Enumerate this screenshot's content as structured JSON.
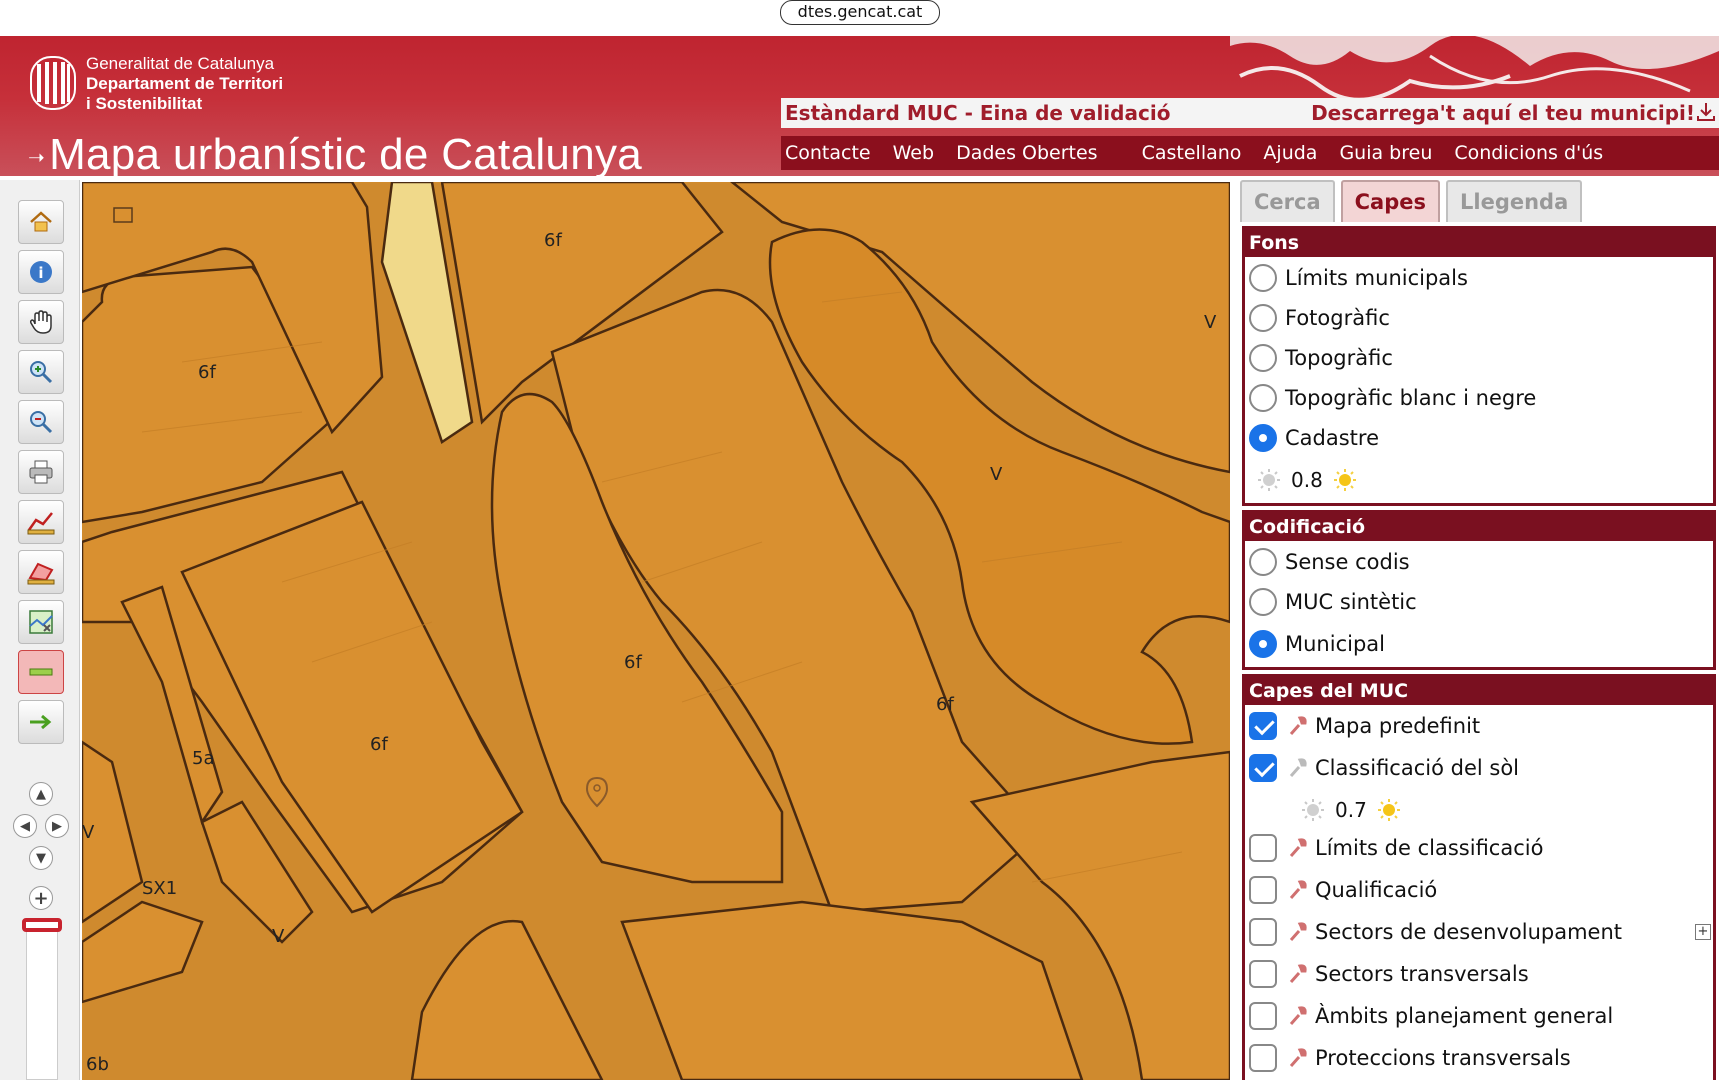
{
  "browser": {
    "url": "dtes.gencat.cat"
  },
  "header": {
    "org_line1": "Generalitat de Catalunya",
    "org_line2": "Departament de Territori",
    "org_line3": "i Sostenibilitat",
    "site_title": "Mapa urbanístic de Catalunya",
    "muc_standard": "Estàndard MUC - Eina de validació",
    "muc_download": "Descarrega't aquí el teu municipi!",
    "nav": [
      {
        "label": "Contacte"
      },
      {
        "label": "Web"
      },
      {
        "label": "Dades Obertes"
      },
      {
        "label": "Castellano"
      },
      {
        "label": "Ajuda"
      },
      {
        "label": "Guia breu"
      },
      {
        "label": "Condicions d'ús"
      }
    ]
  },
  "toolbar": {
    "tools": [
      "home-icon",
      "info-icon",
      "pan-hand-icon",
      "zoom-in-icon",
      "zoom-out-icon",
      "print-icon",
      "measure-distance-icon",
      "measure-area-icon",
      "map-select-icon",
      "layer-bar-icon",
      "next-arrow-icon"
    ]
  },
  "map": {
    "labels": [
      {
        "text": "6f"
      },
      {
        "text": "6f"
      },
      {
        "text": "V"
      },
      {
        "text": "V"
      },
      {
        "text": "6f"
      },
      {
        "text": "6f"
      },
      {
        "text": "5a"
      },
      {
        "text": "6f"
      },
      {
        "text": "SX1"
      },
      {
        "text": "V"
      },
      {
        "text": "V"
      },
      {
        "text": "6b"
      }
    ],
    "colors": {
      "zone": "#d99030",
      "zone_light": "#f0d98a",
      "zone_darker": "#d68a28",
      "road": "#cf8a2e",
      "outline": "#4a2a10"
    }
  },
  "panel": {
    "tabs": [
      {
        "label": "Cerca"
      },
      {
        "label": "Capes",
        "selected": true
      },
      {
        "label": "Llegenda"
      }
    ],
    "fons": {
      "title": "Fons",
      "options": [
        {
          "label": "Límits municipals",
          "selected": false
        },
        {
          "label": "Fotogràfic",
          "selected": false
        },
        {
          "label": "Topogràfic",
          "selected": false
        },
        {
          "label": "Topogràfic blanc i negre",
          "selected": false
        },
        {
          "label": "Cadastre",
          "selected": true
        }
      ],
      "opacity": "0.8"
    },
    "codificacio": {
      "title": "Codificació",
      "options": [
        {
          "label": "Sense codis",
          "selected": false
        },
        {
          "label": "MUC sintètic",
          "selected": false
        },
        {
          "label": "Municipal",
          "selected": true
        }
      ]
    },
    "capes": {
      "title": "Capes del MUC",
      "layers": [
        {
          "label": "Mapa predefinit",
          "checked": true
        },
        {
          "label": "Classificació del sòl",
          "checked": true
        },
        {
          "label": "Límits de classificació",
          "checked": false
        },
        {
          "label": "Qualificació",
          "checked": false
        },
        {
          "label": "Sectors de desenvolupament",
          "checked": false
        },
        {
          "label": "Sectors transversals",
          "checked": false
        },
        {
          "label": "Àmbits planejament general",
          "checked": false
        },
        {
          "label": "Proteccions transversals",
          "checked": false
        }
      ],
      "opacity": "0.7"
    },
    "colors": {
      "accent": "#7a1020",
      "checked": "#1a73e8"
    }
  }
}
